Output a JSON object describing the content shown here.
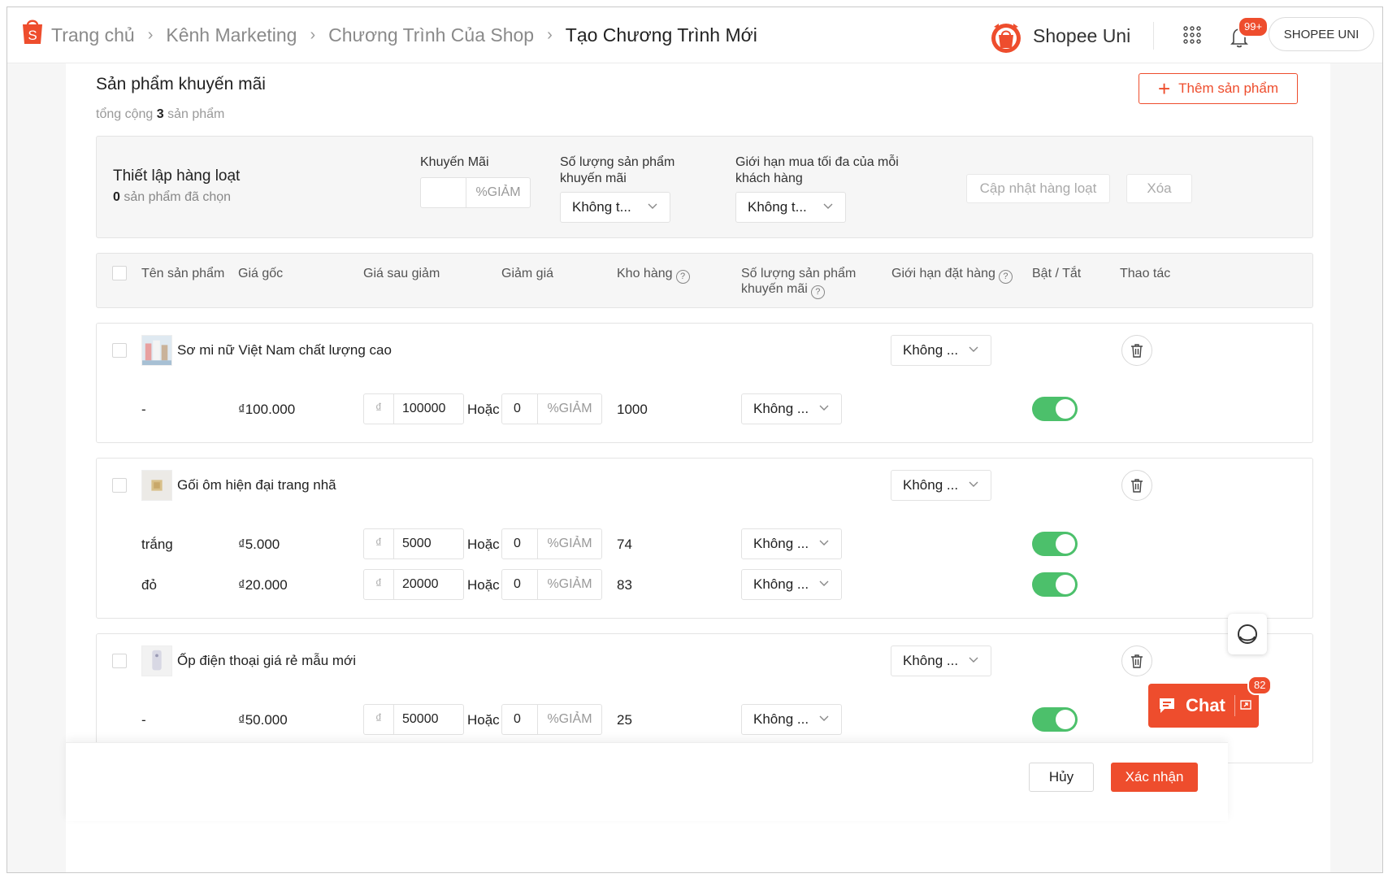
{
  "header": {
    "breadcrumbs": [
      "Trang chủ",
      "Kênh Marketing",
      "Chương Trình Của Shop",
      "Tạo Chương Trình Mới"
    ],
    "uni_label": "Shopee Uni",
    "notification_badge": "99+",
    "shop_button": "SHOPEE UNI"
  },
  "section": {
    "title": "Sản phẩm khuyến mãi",
    "total_prefix": "tổng cộng",
    "total_count": "3",
    "total_suffix": "sản phẩm",
    "add_button": "Thêm sản phẩm"
  },
  "bulk": {
    "title": "Thiết lập hàng loạt",
    "selected_count": "0",
    "selected_suffix": "sản phẩm đã chọn",
    "discount_label": "Khuyến Mãi",
    "discount_suffix": "%GIẢM",
    "qty_label": "Số lượng sản phẩm khuyến mãi",
    "qty_value": "Không t...",
    "limit_label": "Giới hạn mua tối đa của mỗi khách hàng",
    "limit_value": "Không t...",
    "update_button": "Cập nhật hàng loạt",
    "delete_button": "Xóa"
  },
  "table": {
    "columns": [
      "Tên sản phẩm",
      "Giá gốc",
      "Giá sau giảm",
      "Giảm giá",
      "Kho hàng",
      "Số lượng sản phẩm khuyến mãi",
      "Giới hạn đặt hàng",
      "Bật / Tắt",
      "Thao tác"
    ],
    "currency": "₫",
    "or_label": "Hoặc",
    "pct_suffix": "%GIẢM",
    "products": [
      {
        "name": "Sơ mi nữ Việt Nam chất lượng cao",
        "order_limit": "Không ...",
        "variants": [
          {
            "variant": "-",
            "original_price": "₫100.000",
            "sale_price": "100000",
            "discount": "0",
            "stock": "1000",
            "promo_qty": "Không ...",
            "enabled": true
          }
        ]
      },
      {
        "name": "Gối ôm hiện đại trang nhã",
        "order_limit": "Không ...",
        "variants": [
          {
            "variant": "trắng",
            "original_price": "₫5.000",
            "sale_price": "5000",
            "discount": "0",
            "stock": "74",
            "promo_qty": "Không ...",
            "enabled": true
          },
          {
            "variant": "đỏ",
            "original_price": "₫20.000",
            "sale_price": "20000",
            "discount": "0",
            "stock": "83",
            "promo_qty": "Không ...",
            "enabled": true
          }
        ]
      },
      {
        "name": "Ốp điện thoại giá rẻ mẫu mới",
        "order_limit": "Không ...",
        "variants": [
          {
            "variant": "-",
            "original_price": "₫50.000",
            "sale_price": "50000",
            "discount": "0",
            "stock": "25",
            "promo_qty": "Không ...",
            "enabled": true
          }
        ]
      }
    ]
  },
  "footer": {
    "cancel": "Hủy",
    "confirm": "Xác nhận"
  },
  "chat": {
    "label": "Chat",
    "badge": "82"
  },
  "colors": {
    "brand": "#ee4d2d",
    "toggle_on": "#4cc06b"
  }
}
